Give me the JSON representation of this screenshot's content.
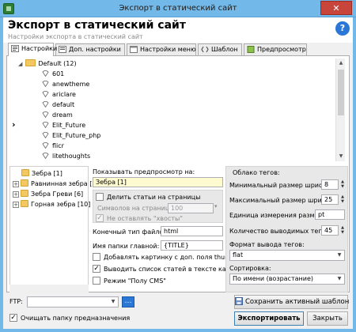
{
  "window": {
    "title": "Экспорт в статический сайт",
    "close_glyph": "✕",
    "header_title": "Экспорт в статический сайт",
    "header_subtitle": "Настройки экспорта в статический сайт",
    "help_glyph": "?"
  },
  "tabs": [
    {
      "label": "Настройки",
      "active": true
    },
    {
      "label": "Доп. настройки",
      "active": false
    },
    {
      "label": "Настройки меню",
      "active": false
    },
    {
      "label": "Шаблон",
      "active": false
    },
    {
      "label": "Предпросмотр",
      "active": false
    }
  ],
  "tree": {
    "root": "Default (12)",
    "items": [
      "601",
      "anewtheme",
      "ariclare",
      "default",
      "dream",
      "Elit_Future",
      "Elit_Future_php",
      "flicr",
      "litethoughts"
    ],
    "selected_marker": "›"
  },
  "list2": {
    "items": [
      "Зебра [1]",
      "Равнинная зебра [",
      "Зебра Греви [6]",
      "Горная зебра [10]"
    ]
  },
  "middle": {
    "preview_label": "Показывать предпросмотр на:",
    "preview_value": "Зебра [1]",
    "split_label": "Делить статьи на страницы",
    "chars_label": "Символов на странице:",
    "chars_value": "100",
    "no_tails_label": "Не оставлять \"хвосты\"",
    "filetype_label": "Конечный тип файлов:",
    "filetype_value": "html",
    "mainfolder_label": "Имя папки главной:",
    "mainfolder_value": "{TITLE}",
    "opt_thumb_label": "Добавлять картинку с доп. поля thumb",
    "opt_list_label": "Выводить список статей в тексте катег.",
    "opt_cms_label": "Режим \"Полу CMS\""
  },
  "cloud": {
    "group_label": "Облако тегов:",
    "min_label": "Минимальный размер шрифта:",
    "min_value": "8",
    "max_label": "Максимальный размер шрифта:",
    "max_value": "25",
    "unit_label": "Единица измерения размера:",
    "unit_value": "pt",
    "count_label": "Количество выводимых тегов:",
    "count_value": "45",
    "format_label": "Формат вывода тегов:",
    "format_value": "flat",
    "sort_label": "Сортировка:",
    "sort_value": "По имени (возрастание)"
  },
  "bottom": {
    "ftp_label": "FTP:",
    "ftp_value": "",
    "dots_label": "…",
    "save_template_label": "Сохранить активный шаблон",
    "clear_folder_label": "Очищать папку предназначения",
    "export_label": "Экспортировать",
    "close_label": "Закрыть"
  }
}
